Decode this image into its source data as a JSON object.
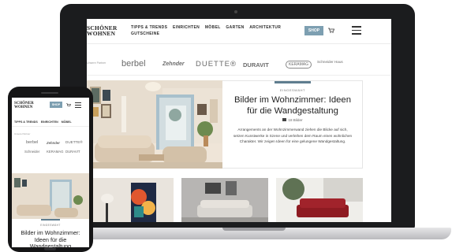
{
  "site": {
    "logo": "SCHÖNER WOHNEN",
    "nav": [
      "TIPPS & TRENDS",
      "EINRICHTEN",
      "MÖBEL",
      "GARTEN",
      "ARCHITEKTUR",
      "GUTSCHEINE"
    ],
    "shop_label": "SHOP",
    "partners_label": "Unsere Partner",
    "partners": [
      "berbel",
      "Zehnder",
      "DUETTE®",
      "DURAVIT",
      "KERAMAG",
      "Schneider Haus"
    ]
  },
  "hero": {
    "kicker": "EINGESWÄHT",
    "title": "Bilder im Wohnzimmer: Ideen für die Wandgestaltung",
    "count": "18 Bilder",
    "description": "Arrangements an der Wohnzimmerwand ziehen die Blicke auf sich, setzen Kunstwerke in Szene und verleihen dem Raum einen wohnlichen Charakter. Wir zeigen Ideen für eine gelungene Wandgestaltung."
  },
  "mobile": {
    "logo": "SCHÖNER WOHNEN",
    "shop_label": "SHOP",
    "nav": [
      "TIPPS & TRENDS",
      "EINRICHTEN",
      "MÖBEL"
    ],
    "partners_label": "Unsere Partner",
    "partners": [
      "berbel",
      "Zehnder",
      "DUETTE®",
      "Schneider",
      "KERAMAG",
      "DURAVIT"
    ],
    "hero_kicker": "EINGESWÄHT",
    "hero_title": "Bilder im Wohnzimmer: Ideen für die Wandgestaltung"
  },
  "icons": [
    "cart-icon",
    "hamburger-menu-icon",
    "gallery-icon"
  ],
  "colors": {
    "accent": "#5f7d8f",
    "shop_button": "#7d9fb1",
    "device": "#1b1c1e"
  }
}
